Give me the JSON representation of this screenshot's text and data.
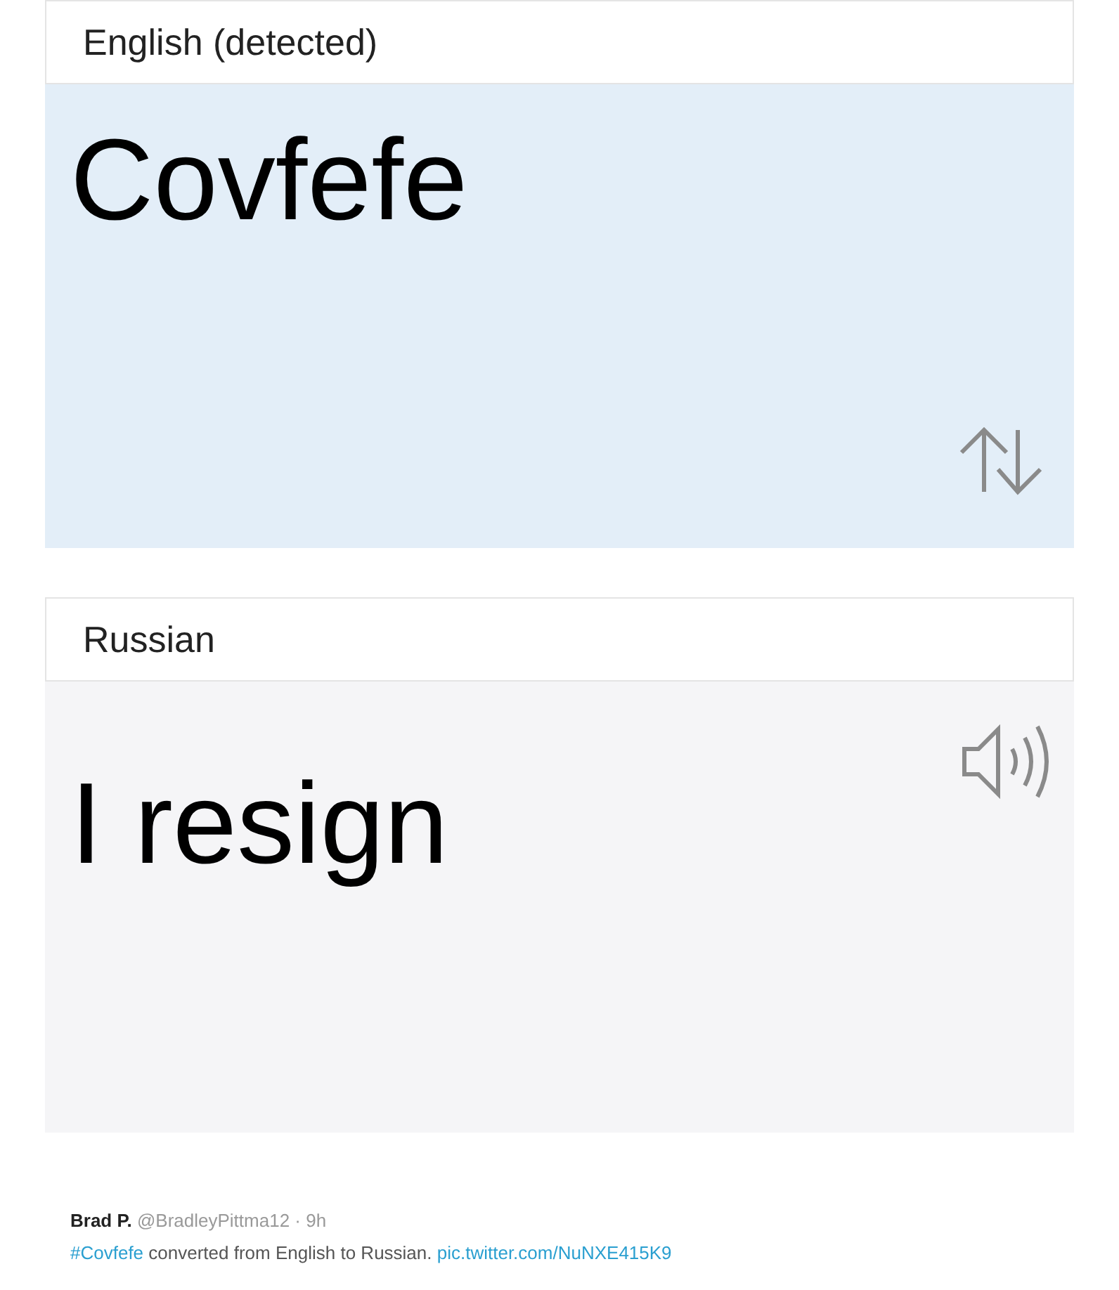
{
  "source": {
    "language": "English (detected)",
    "text": "Covfefe"
  },
  "target": {
    "language": "Russian",
    "text": "I resign"
  },
  "tweet": {
    "name": "Brad P.",
    "handle": "@BradleyPittma12",
    "time": "· 9h",
    "hashtag": "#Covfefe",
    "text": "converted from English to Russian.",
    "link": "pic.twitter.com/NuNXE415K9"
  }
}
